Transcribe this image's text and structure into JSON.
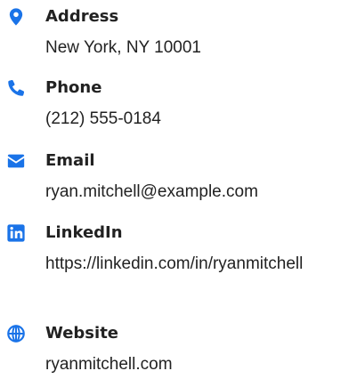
{
  "theme": {
    "accent": "#1a73e8"
  },
  "contacts": [
    {
      "icon": "location-pin-icon",
      "label": "Address",
      "value": "New York, NY 10001"
    },
    {
      "icon": "phone-icon",
      "label": "Phone",
      "value": "(212) 555-0184"
    },
    {
      "icon": "envelope-icon",
      "label": "Email",
      "value": "ryan.mitchell@example.com"
    },
    {
      "icon": "linkedin-icon",
      "label": "LinkedIn",
      "value": "https://linkedin.com/in/ryanmitchell"
    },
    {
      "icon": "globe-icon",
      "label": "Website",
      "value": "ryanmitchell.com"
    }
  ]
}
